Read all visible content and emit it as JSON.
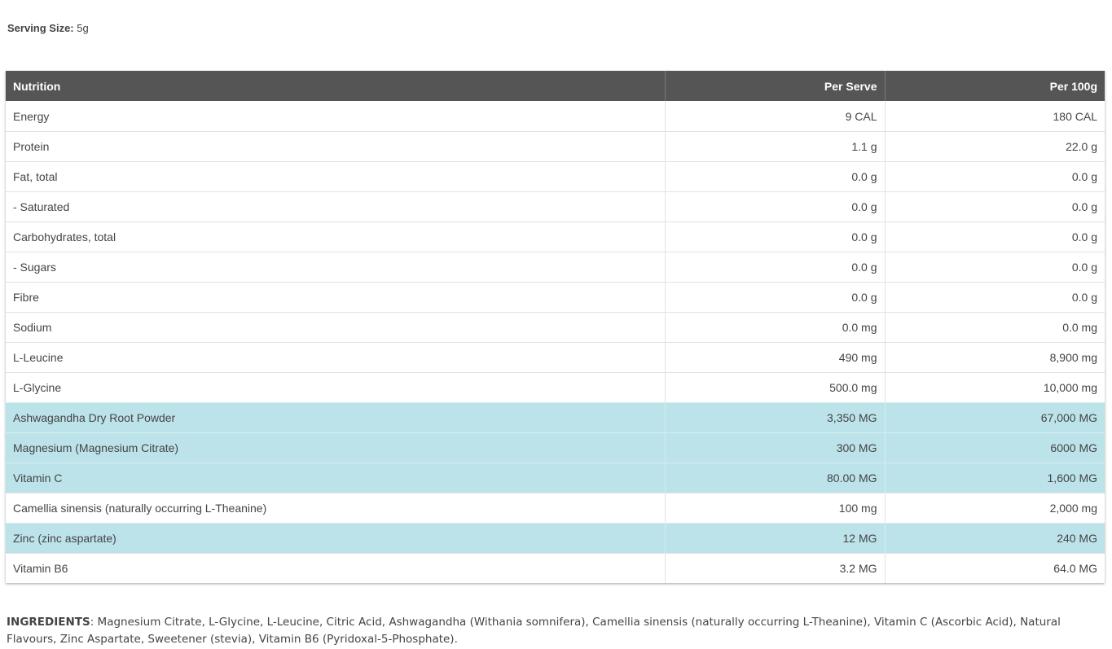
{
  "serving": {
    "label": "Serving Size:",
    "value": " 5g"
  },
  "table": {
    "headers": [
      "Nutrition",
      "Per Serve",
      "Per 100g"
    ],
    "rows": [
      {
        "name": "Energy",
        "per_serve": "9 CAL",
        "per_100g": "180 CAL",
        "highlight": false
      },
      {
        "name": "Protein",
        "per_serve": "1.1 g",
        "per_100g": "22.0 g",
        "highlight": false
      },
      {
        "name": "Fat, total",
        "per_serve": "0.0 g",
        "per_100g": "0.0 g",
        "highlight": false
      },
      {
        "name": "- Saturated",
        "per_serve": "0.0 g",
        "per_100g": "0.0 g",
        "highlight": false
      },
      {
        "name": "Carbohydrates, total",
        "per_serve": "0.0 g",
        "per_100g": "0.0 g",
        "highlight": false
      },
      {
        "name": "- Sugars",
        "per_serve": "0.0 g",
        "per_100g": "0.0 g",
        "highlight": false
      },
      {
        "name": "Fibre",
        "per_serve": "0.0 g",
        "per_100g": "0.0 g",
        "highlight": false
      },
      {
        "name": "Sodium",
        "per_serve": "0.0 mg",
        "per_100g": "0.0 mg",
        "highlight": false
      },
      {
        "name": "L-Leucine",
        "per_serve": "490 mg",
        "per_100g": "8,900 mg",
        "highlight": false
      },
      {
        "name": "L-Glycine",
        "per_serve": "500.0 mg",
        "per_100g": "10,000 mg",
        "highlight": false
      },
      {
        "name": "Ashwagandha Dry Root Powder",
        "per_serve": "3,350 MG",
        "per_100g": "67,000 MG",
        "highlight": true
      },
      {
        "name": "Magnesium (Magnesium Citrate)",
        "per_serve": "300 MG",
        "per_100g": "6000 MG",
        "highlight": true
      },
      {
        "name": "Vitamin C",
        "per_serve": "80.00 MG",
        "per_100g": "1,600 MG",
        "highlight": true
      },
      {
        "name": "Camellia sinensis (naturally occurring L-Theanine)",
        "per_serve": "100 mg",
        "per_100g": "2,000 mg",
        "highlight": false
      },
      {
        "name": "Zinc (zinc aspartate)",
        "per_serve": "12 MG",
        "per_100g": "240 MG",
        "highlight": true
      },
      {
        "name": "Vitamin B6",
        "per_serve": "3.2 MG",
        "per_100g": "64.0 MG",
        "highlight": false
      }
    ]
  },
  "ingredients": {
    "label": "INGREDIENTS",
    "text": ": Magnesium Citrate, L-Glycine, L-Leucine, Citric Acid, Ashwagandha (Withania somnifera), Camellia sinensis (naturally occurring L-Theanine), Vitamin C (Ascorbic Acid), Natural Flavours, Zinc Aspartate, Sweetener (stevia), Vitamin B6 (Pyridoxal-5-Phosphate)."
  },
  "colors": {
    "header_bg": "#555555",
    "highlight_bg": "#bde3ea"
  }
}
